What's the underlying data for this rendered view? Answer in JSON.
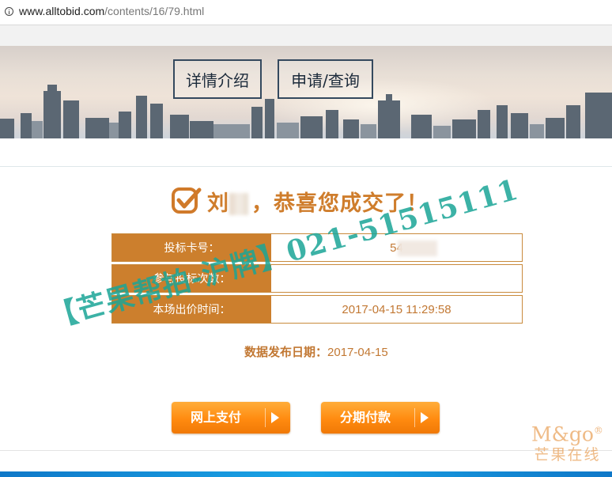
{
  "browser": {
    "url_host": "www.alltobid.com",
    "url_path": "/contents/16/79.html"
  },
  "banner": {
    "detail_label": "详情介绍",
    "apply_label": "申请/查询"
  },
  "result": {
    "name_prefix": "刘",
    "message": "，恭喜您成交了！"
  },
  "table": {
    "rows": [
      {
        "label": "投标卡号：",
        "value": "54"
      },
      {
        "label": "参与投标次数：",
        "value": ""
      },
      {
        "label": "本场出价时间：",
        "value": "2017-04-15 11:29:58"
      }
    ]
  },
  "release": {
    "label": "数据发布日期：",
    "date": "2017-04-15"
  },
  "buttons": {
    "pay_online": "网上支付",
    "installment": "分期付款"
  },
  "watermark": "【芒果帮拍-沪牌】021-51515111",
  "brand": {
    "en": "M&go",
    "reg": "®",
    "cn": "芒果在线"
  },
  "colors": {
    "accent": "#cc7f2d",
    "watermark": "#1aa596",
    "bottom_band": "#1aa4e6"
  }
}
